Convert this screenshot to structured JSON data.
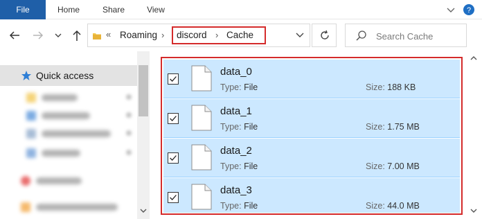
{
  "ribbon": {
    "tabs": [
      {
        "label": "File"
      },
      {
        "label": "Home"
      },
      {
        "label": "Share"
      },
      {
        "label": "View"
      }
    ]
  },
  "address": {
    "breadcrumb": [
      "«",
      "Roaming",
      "discord",
      "Cache"
    ],
    "highlight_color": "#d42b2b"
  },
  "search": {
    "placeholder": "Search Cache"
  },
  "nav_pane": {
    "quick_access_label": "Quick access"
  },
  "files": {
    "type_label": "Type:",
    "size_label": "Size:",
    "items": [
      {
        "name": "data_0",
        "type": "File",
        "size": "188 KB",
        "checked": true
      },
      {
        "name": "data_1",
        "type": "File",
        "size": "1.75 MB",
        "checked": true
      },
      {
        "name": "data_2",
        "type": "File",
        "size": "7.00 MB",
        "checked": true
      },
      {
        "name": "data_3",
        "type": "File",
        "size": "44.0 MB",
        "checked": true
      }
    ]
  },
  "colors": {
    "file_tab": "#1f5fa8",
    "selection_fill": "#cce8ff",
    "selection_border": "#99d1ff",
    "annotation_red": "#d42b2b"
  }
}
